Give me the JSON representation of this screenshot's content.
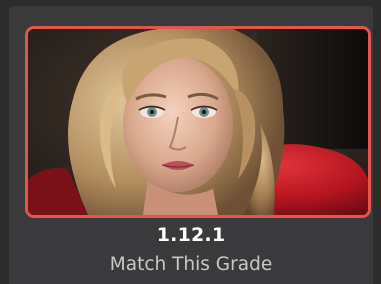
{
  "clip": {
    "number": "1.12.1",
    "label": "Match This Grade",
    "selected": true,
    "thumbnail_icon": "portrait-thumbnail"
  },
  "colors": {
    "background": "#2c2c2c",
    "card": "#3a3a3c",
    "selection_border": "#e2564b",
    "number_text": "#ffffff",
    "label_text": "#c8c8c8"
  }
}
